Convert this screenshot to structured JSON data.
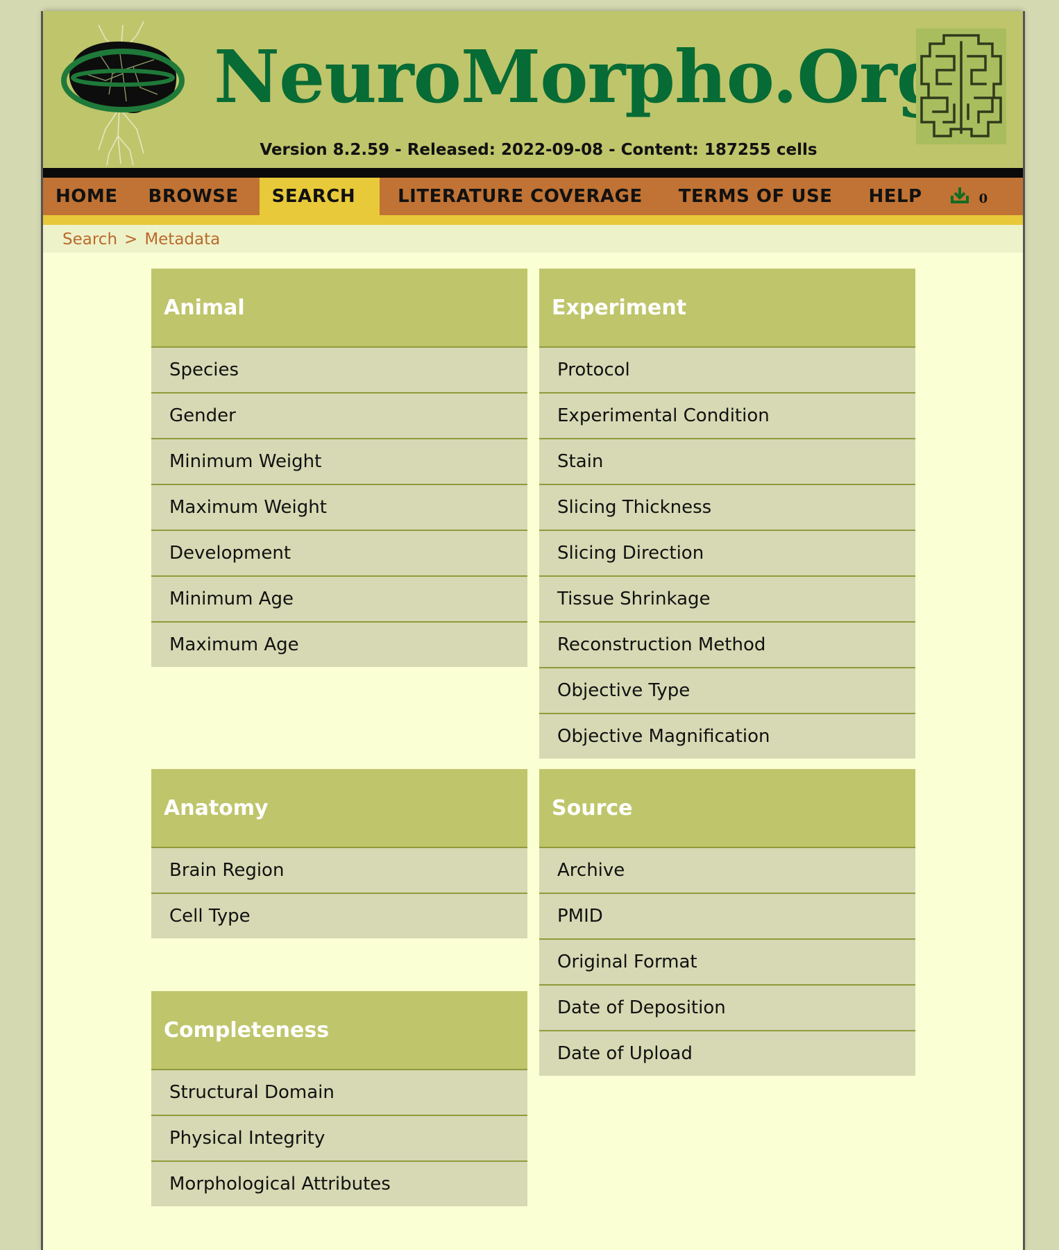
{
  "header": {
    "site_title": "NeuroMorpho.Org",
    "version_line": "Version 8.2.59 - Released: 2022-09-08 - Content: 187255 cells"
  },
  "nav": {
    "home": "HOME",
    "browse": "BROWSE",
    "search": "SEARCH",
    "literature": "LITERATURE COVERAGE",
    "terms": "TERMS OF USE",
    "help": "HELP",
    "cart_count": "0",
    "active": "SEARCH"
  },
  "breadcrumb": {
    "search": "Search",
    "separator": ">",
    "metadata": "Metadata"
  },
  "panels": {
    "animal": {
      "title": "Animal",
      "items": [
        "Species",
        "Gender",
        "Minimum Weight",
        "Maximum Weight",
        "Development",
        "Minimum Age",
        "Maximum Age"
      ]
    },
    "experiment": {
      "title": "Experiment",
      "items": [
        "Protocol",
        "Experimental Condition",
        "Stain",
        "Slicing Thickness",
        "Slicing Direction",
        "Tissue Shrinkage",
        "Reconstruction Method",
        "Objective Type",
        "Objective Magnification"
      ]
    },
    "anatomy": {
      "title": "Anatomy",
      "items": [
        "Brain Region",
        "Cell Type"
      ]
    },
    "source": {
      "title": "Source",
      "items": [
        "Archive",
        "PMID",
        "Original Format",
        "Date of Deposition",
        "Date of Upload"
      ]
    },
    "completeness": {
      "title": "Completeness",
      "items": [
        "Structural Domain",
        "Physical Integrity",
        "Morphological Attributes"
      ]
    }
  },
  "colors": {
    "header_bg": "#bfc56b",
    "title_green": "#076b35",
    "nav_bg": "#c07334",
    "nav_active": "#e8c93a",
    "page_bg": "#fbffd4",
    "item_bg": "#d6d9b3",
    "breadcrumb_text": "#b96a2c"
  },
  "icons": {
    "left_logo": "brain-neuron-logo-icon",
    "right_logo": "brain-maze-logo-icon",
    "cart": "download-cart-icon"
  }
}
